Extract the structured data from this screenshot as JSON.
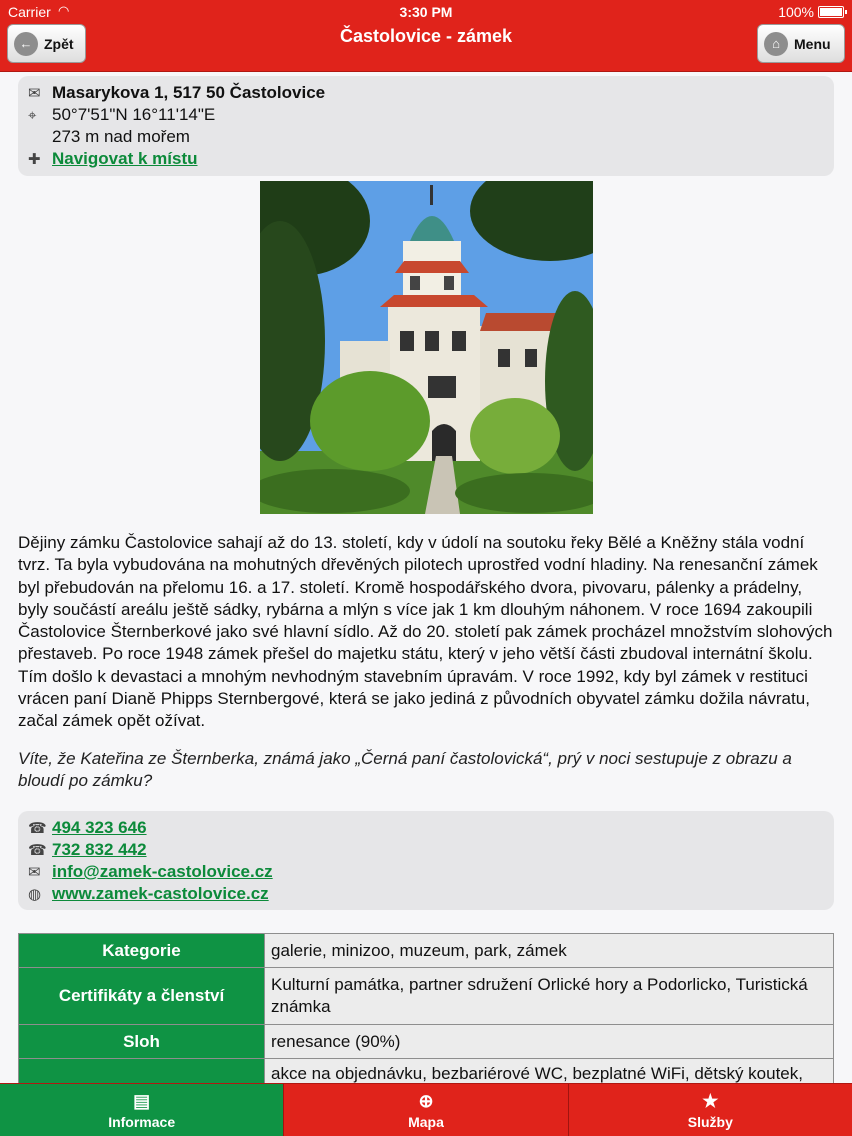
{
  "status": {
    "carrier": "Carrier",
    "time": "3:30 PM",
    "battery": "100%"
  },
  "nav": {
    "title": "Častolovice - zámek",
    "back_label": "Zpět",
    "menu_label": "Menu"
  },
  "address": {
    "street": "Masarykova 1, 517 50 Častolovice",
    "gps": "50°7'51\"N 16°11'14\"E",
    "altitude": "273 m nad mořem",
    "navigate": "Navigovat k místu"
  },
  "description": "Dějiny zámku Častolovice sahají až do 13. století, kdy v údolí na soutoku řeky Bělé a Kněžny stála vodní tvrz. Ta byla vybudována na mohutných dřevěných pilotech uprostřed vodní hladiny. Na renesanční zámek byl přebudován na přelomu 16. a 17. století. Kromě hospodářského dvora, pivovaru, pálenky a prádelny, byly součástí areálu ještě sádky, rybárna a mlýn s více jak 1 km dlouhým náhonem. V roce 1694 zakoupili Častolovice Šternberkové jako své hlavní sídlo. Až do 20. století pak zámek procházel množstvím slohových přestaveb. Po roce 1948 zámek přešel do majetku státu, který v jeho větší části zbudoval internátní školu. Tím došlo k devastaci a mnohým nevhodným stavebním úpravám. V roce 1992, kdy byl zámek v restituci vrácen paní Dianě Phipps Sternbergové, která se jako jediná z původních obyvatel zámku dožila návratu, začal zámek opět ožívat.",
  "fact": "Víte, že Kateřina ze Šternberka, známá jako „Černá paní častolovická“, prý v noci sestupuje z obrazu a bloudí po zámku?",
  "contacts": {
    "phone1": "494 323 646",
    "phone2": "732 832 442",
    "email": "info@zamek-castolovice.cz",
    "web": "www.zamek-castolovice.cz"
  },
  "table": {
    "rows": [
      {
        "key": "Kategorie",
        "value": "galerie, minizoo, muzeum, park, zámek"
      },
      {
        "key": "Certifikáty a členství",
        "value": "Kulturní památka, partner sdružení Orlické hory a Podorlicko, Turistická známka"
      },
      {
        "key": "Sloh",
        "value": "renesance (90%)"
      },
      {
        "key": "",
        "value": "akce na objednávku, bezbariérové WC, bezplatné WiFi, dětský koutek,"
      }
    ]
  },
  "tabs": {
    "info": "Informace",
    "map": "Mapa",
    "services": "Služby"
  },
  "colors": {
    "header": "#e0231b",
    "accent_green": "#0f9344",
    "link": "#0c8a3a"
  }
}
